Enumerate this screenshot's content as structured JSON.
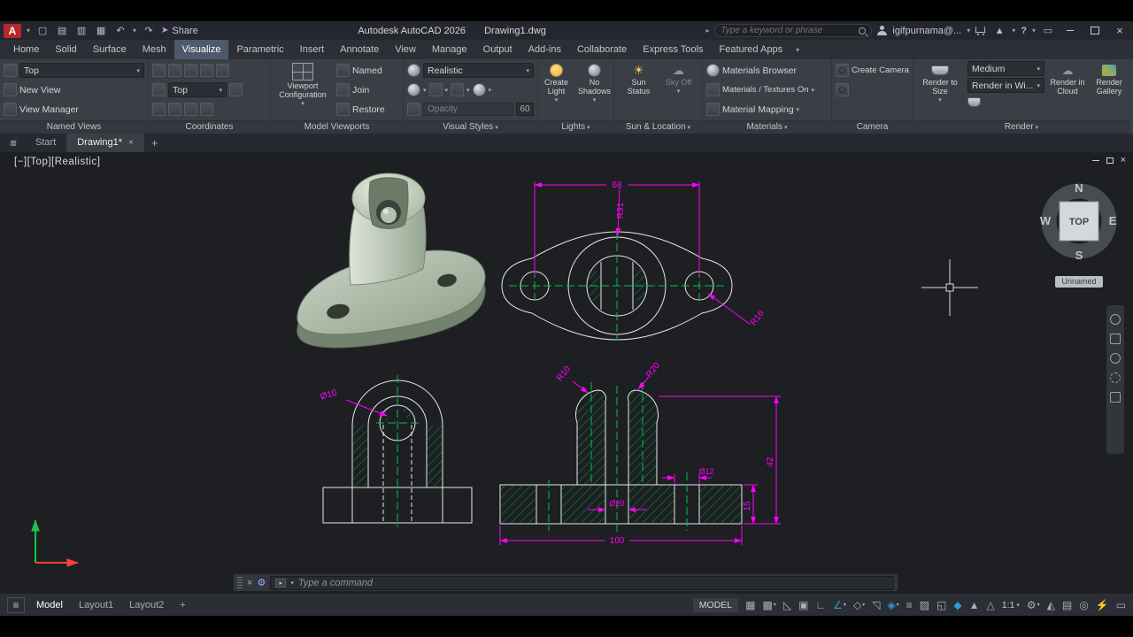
{
  "icons": {
    "caret": "▾",
    "caret_right": "▸",
    "close": "×",
    "plus": "+",
    "hamburger": "≡",
    "new_doc": "▢",
    "open_doc": "▤",
    "save_doc": "▥",
    "plot_doc": "▦",
    "undo": "↶",
    "redo": "↷",
    "share_arrow": "➤",
    "access": "▲",
    "help": "?",
    "screen": "▭",
    "gear": "⚙",
    "sun": "☀",
    "cloud": "☁",
    "prompt": "▸"
  },
  "titlebar": {
    "title": "Autodesk AutoCAD 2026",
    "document": "Drawing1.dwg",
    "share": "Share",
    "search_placeholder": "Type a keyword or phrase",
    "user": "igifpurnama@..."
  },
  "ribbon": {
    "tabs": [
      "Home",
      "Solid",
      "Surface",
      "Mesh",
      "Visualize",
      "Parametric",
      "Insert",
      "Annotate",
      "View",
      "Manage",
      "Output",
      "Add-ins",
      "Collaborate",
      "Express Tools",
      "Featured Apps"
    ]
  },
  "panels": {
    "named_views": {
      "label": "Named Views",
      "view": "Top",
      "new_view": "New View",
      "view_manager": "View Manager"
    },
    "coordinates": {
      "label": "Coordinates",
      "view": "Top"
    },
    "model_viewports": {
      "label": "Model Viewports",
      "viewport_configuration": "Viewport\nConfiguration",
      "named": "Named",
      "join": "Join",
      "restore": "Restore"
    },
    "visual_styles": {
      "label": "Visual Styles",
      "style": "Realistic",
      "opacity": "Opacity",
      "opacity_value": "60"
    },
    "lights": {
      "label": "Lights",
      "create_light": "Create\nLight",
      "no_shadows": "No\nShadows"
    },
    "sun_location": {
      "label": "Sun & Location",
      "sun_status": "Sun\nStatus",
      "sky_off": "Sky Off"
    },
    "materials": {
      "label": "Materials",
      "browser": "Materials Browser",
      "textures_on": "Materials / Textures On",
      "mapping": "Material Mapping"
    },
    "camera": {
      "label": "Camera",
      "create_camera": "Create Camera"
    },
    "render": {
      "label": "Render",
      "render_to_size": "Render to\nSize",
      "quality": "Medium",
      "output": "Render in Wi...",
      "cloud": "Render in\nCloud",
      "gallery": "Render\nGallery"
    }
  },
  "file_tabs": {
    "start": "Start",
    "drawing": "Drawing1*"
  },
  "viewport": {
    "controls": "[−][Top][Realistic]",
    "viewcube": {
      "n": "N",
      "e": "E",
      "s": "S",
      "w": "W",
      "face": "TOP"
    },
    "badge": "Unnamed"
  },
  "drawing": {
    "dims": {
      "width_68": "68",
      "r31": "R31",
      "r16": "R16",
      "dia10": "Ø10",
      "r10": "R10",
      "r20": "R20",
      "dia12": "Ø12",
      "dia20": "Ø20",
      "h15": "15",
      "h42": "42",
      "w100": "100"
    },
    "colors": {
      "dimension": "#ff00ff",
      "geometry": "#e8e8e8",
      "centerline": "#00c050",
      "hatch": "#00a040"
    }
  },
  "command": {
    "placeholder": "Type a command"
  },
  "status": {
    "model_tab": "Model",
    "layout1": "Layout1",
    "layout2": "Layout2",
    "space": "MODEL",
    "scale": "1:1",
    "icons_a": [
      {
        "name": "grid-icon",
        "glyph": "▦",
        "on": false
      },
      {
        "name": "snap-icon",
        "glyph": "▩",
        "on": false
      },
      {
        "name": "infer-constraints-icon",
        "glyph": "◺",
        "on": false
      },
      {
        "name": "dynamic-input-icon",
        "glyph": "▣",
        "on": false
      },
      {
        "name": "ortho-icon",
        "glyph": "∟",
        "on": false
      },
      {
        "name": "polar-tracking-icon",
        "glyph": "∠",
        "on": true
      },
      {
        "name": "isometric-drafting-icon",
        "glyph": "◇",
        "on": false
      },
      {
        "name": "object-snap-tracking-icon",
        "glyph": "◹",
        "on": false
      },
      {
        "name": "object-snap-icon",
        "glyph": "◈",
        "on": true
      },
      {
        "name": "lineweight-icon",
        "glyph": "≡",
        "on": false
      },
      {
        "name": "transparency-icon",
        "glyph": "▨",
        "on": false
      },
      {
        "name": "selection-cycling-icon",
        "glyph": "◱",
        "on": false
      },
      {
        "name": "3d-object-snap-icon",
        "glyph": "◆",
        "on": true
      },
      {
        "name": "annotation-visibility-icon",
        "glyph": "▲",
        "on": false
      },
      {
        "name": "autoscale-icon",
        "glyph": "△",
        "on": false
      }
    ],
    "icons_b": [
      {
        "name": "annotation-monitor-icon",
        "glyph": "◭",
        "on": false
      },
      {
        "name": "quick-properties-icon",
        "glyph": "▤",
        "on": false
      },
      {
        "name": "isolate-objects-icon",
        "glyph": "◎",
        "on": false
      },
      {
        "name": "graphics-performance-icon",
        "glyph": "⚡",
        "on": true
      },
      {
        "name": "clean-screen-icon",
        "glyph": "▭",
        "on": false
      }
    ]
  }
}
